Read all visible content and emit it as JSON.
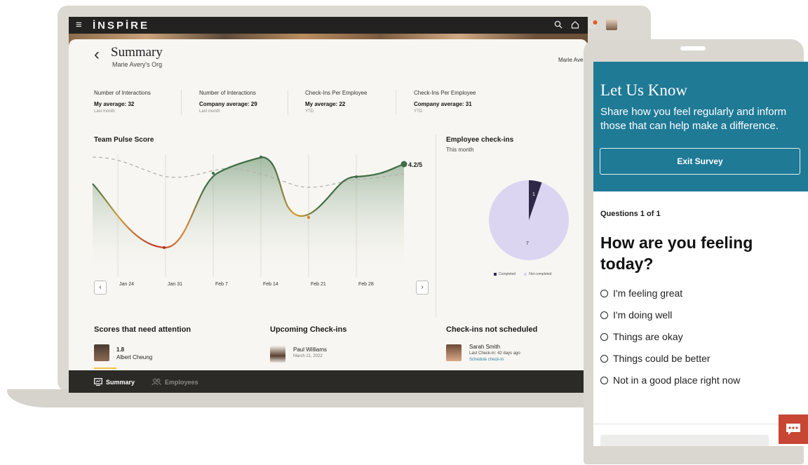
{
  "app": {
    "brand": "İNSPİRE"
  },
  "summary": {
    "title": "Summary",
    "subtitle": "Marie Avery's Org",
    "owner": "Marie Ave"
  },
  "stats": [
    {
      "label": "Number of Interactions",
      "value": "My average: 32",
      "period": "Last month"
    },
    {
      "label": "Number of Interactions",
      "value": "Company average: 29",
      "period": "Last month"
    },
    {
      "label": "Check-Ins Per Employee",
      "value": "My average: 22",
      "period": "YTD"
    },
    {
      "label": "Check-Ins Per Employee",
      "value": "Company average: 31",
      "period": "YTD"
    }
  ],
  "pulse": {
    "title": "Team Pulse Score",
    "current_label": "4.2/5",
    "ticks": [
      "Jan 24",
      "Jan 31",
      "Feb 7",
      "Feb 14",
      "Feb 21",
      "Feb 28"
    ],
    "prev_arrow": "‹",
    "next_arrow": "›",
    "colors": {
      "line": "#3f6e46",
      "low": "#c0392b",
      "mid": "#e0a030",
      "avg": "#b5b3ad"
    }
  },
  "checkins": {
    "title": "Employee check-ins",
    "subtitle": "This month",
    "completed_value": "1",
    "not_completed_value": "7",
    "legend_completed": "Completed",
    "legend_not_completed": "Not completed",
    "colors": {
      "completed": "#2f2947",
      "not_completed": "#dcd5f2"
    }
  },
  "attention": {
    "title": "Scores that need attention",
    "score": "1.8",
    "name": "Albert Cheung"
  },
  "upcoming": {
    "title": "Upcoming Check-ins",
    "name": "Paul Williams",
    "date": "March 21, 2022"
  },
  "not_scheduled": {
    "title": "Check-ins not scheduled",
    "name": "Sarah Smith",
    "last": "Last Check-in: 42 days ago",
    "link": "Schedule check-in"
  },
  "tabs": [
    {
      "label": "Summary"
    },
    {
      "label": "Employees"
    }
  ],
  "survey": {
    "title": "Let Us Know",
    "description": "Share how you feel regularly and inform those that can help make a difference.",
    "exit_label": "Exit Survey",
    "count": "Questions 1 of 1",
    "question": "How are you feeling today?",
    "options": [
      "I'm feeling great",
      "I'm doing well",
      "Things are okay",
      "Things could be better",
      "Not in a good place right now"
    ],
    "accent": "#1f7a96",
    "chat_color": "#c74634"
  }
}
